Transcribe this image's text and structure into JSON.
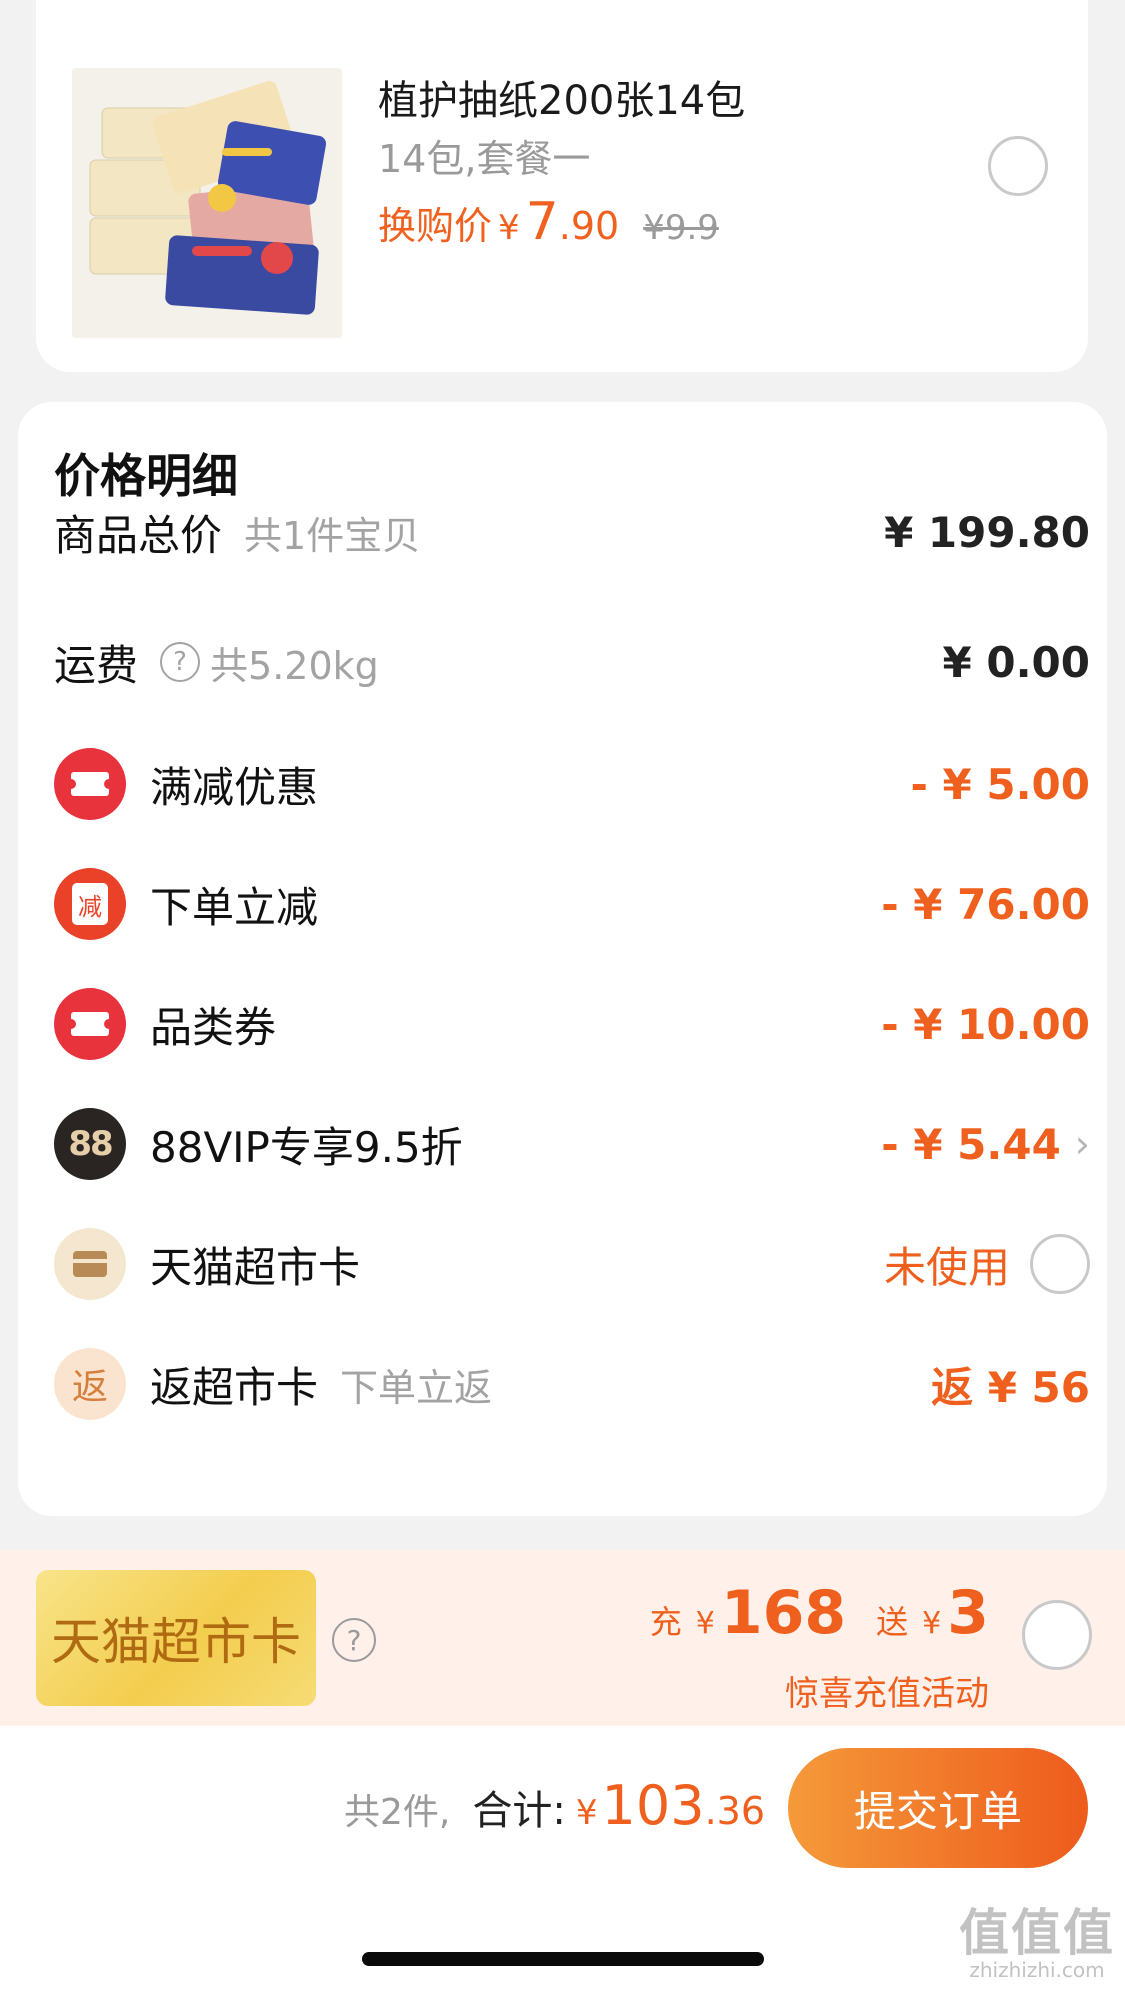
{
  "product": {
    "title": "植护抽纸200张14包",
    "spec": "14包,套餐一",
    "price_label": "换购价",
    "yen": "¥",
    "price_int": "7",
    "price_dec": ".90",
    "original_price": "¥9.9"
  },
  "price_detail": {
    "title": "价格明细",
    "rows": [
      {
        "label": "商品总价",
        "sub": "共1件宝贝",
        "value": "¥ 199.80"
      },
      {
        "label": "运费",
        "help": "?",
        "sub": "共5.20kg",
        "value": "¥ 0.00"
      },
      {
        "label": "满减优惠",
        "value": "- ¥ 5.00"
      },
      {
        "label": "下单立减",
        "icon_text": "减",
        "value": "- ¥ 76.00"
      },
      {
        "label": "品类券",
        "value": "- ¥ 10.00"
      },
      {
        "label": "88VIP专享9.5折",
        "icon_text": "88",
        "value": "- ¥ 5.44",
        "chevron": "›"
      },
      {
        "label": "天猫超市卡",
        "value": "未使用"
      },
      {
        "label": "返超市卡",
        "icon_text": "返",
        "sub": "下单立返",
        "value": "返 ¥ 56"
      }
    ]
  },
  "promo": {
    "card_label": "天猫超市卡",
    "help": "?",
    "charge_label": "充",
    "yen": "¥",
    "charge_amount": "168",
    "gift_label": "送",
    "gift_amount": "3",
    "subtitle": "惊喜充值活动"
  },
  "bottom": {
    "count": "共2件,",
    "total_label": "合计:",
    "yen": "¥",
    "total_int": "103",
    "total_dec": ".36",
    "submit_label": "提交订单"
  },
  "watermark": {
    "logo": "值值值",
    "url": "zhizhizhi.com"
  },
  "colors": {
    "accent": "#ef5f1d",
    "coupon_red": "#e8323c",
    "button_gradient_start": "#f49a3a",
    "button_gradient_end": "#ee5b1c",
    "vip_black": "#2a2522"
  }
}
